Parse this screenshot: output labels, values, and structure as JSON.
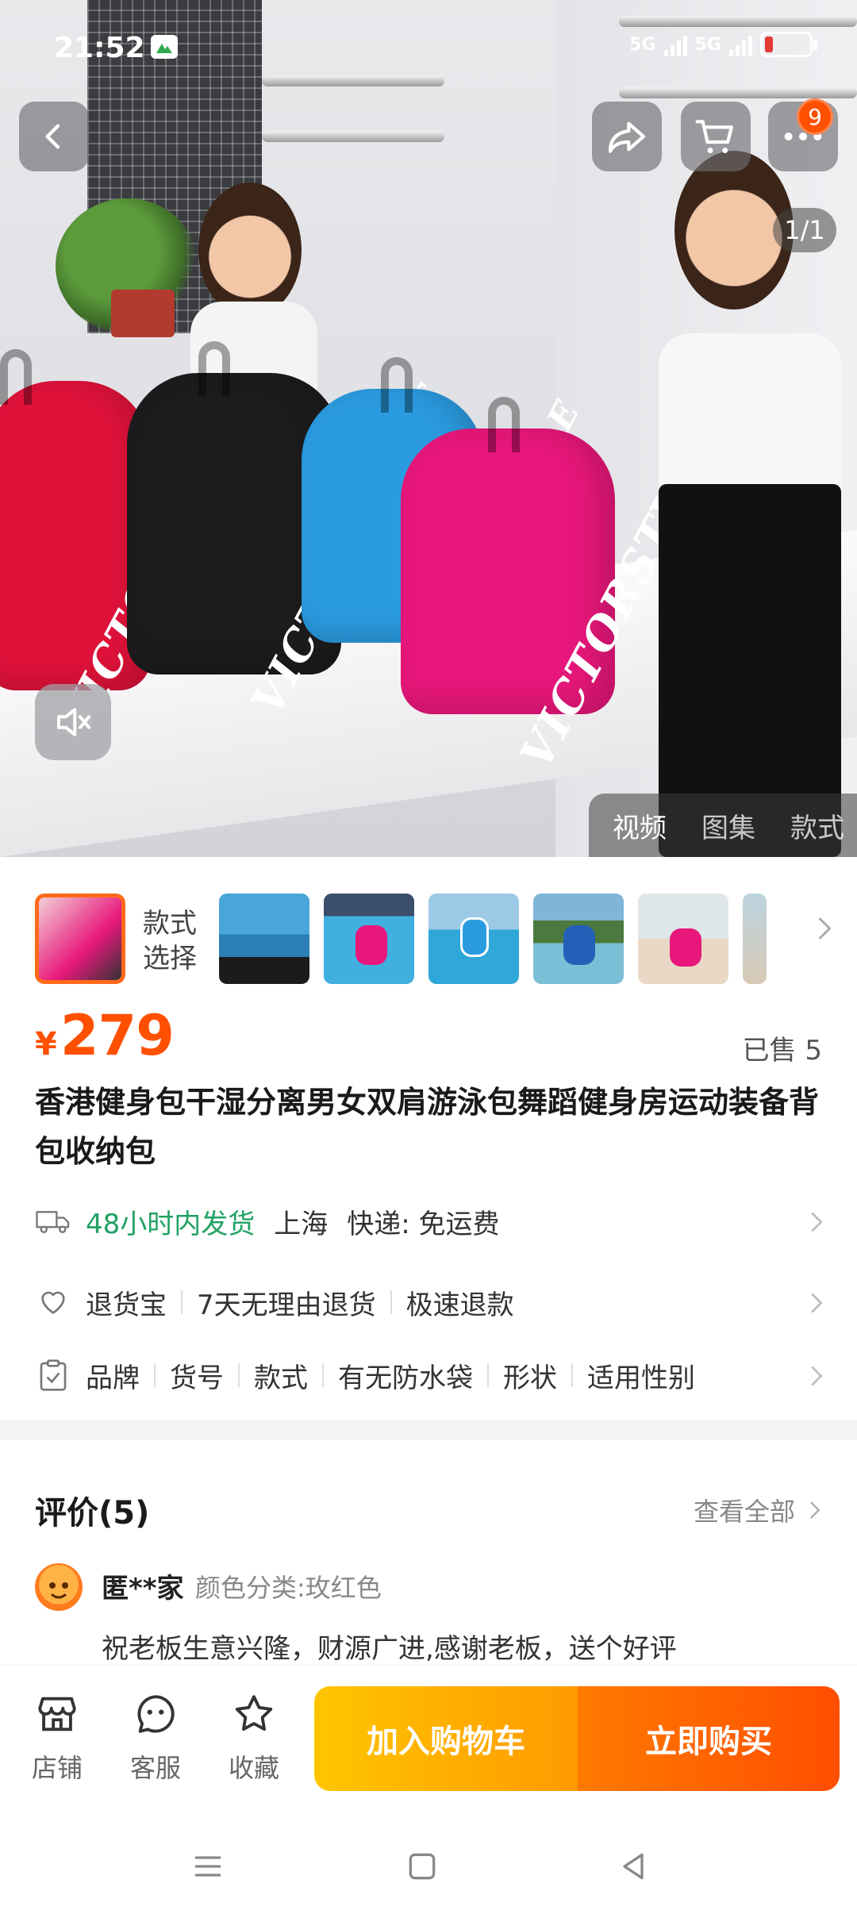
{
  "status_bar": {
    "time": "21:52",
    "network_1": "5G",
    "network_2": "5G",
    "battery_color": "#e53935"
  },
  "nav": {
    "cart_badge": "9"
  },
  "media": {
    "page_counter": "1/1",
    "tabs": [
      "视频",
      "图集",
      "款式"
    ],
    "active_tab": "视频",
    "bag_logo": "VICTORSTYLE",
    "bag_colors": [
      "#e0123a",
      "#1c1c1e",
      "#2b9be0",
      "#e8177b"
    ]
  },
  "variants": {
    "label": "款式\n选择",
    "label_line1": "款式",
    "label_line2": "选择"
  },
  "product": {
    "currency": "¥",
    "price": "279",
    "sold": "已售 5",
    "title": "香港健身包干湿分离男女双肩游泳包舞蹈健身房运动装备背包收纳包"
  },
  "shipping": {
    "dispatch": "48小时内发货",
    "location": "上海",
    "courier": "快递: 免运费"
  },
  "services": {
    "items": [
      "退货宝",
      "7天无理由退货",
      "极速退款"
    ]
  },
  "params": {
    "items": [
      "品牌",
      "货号",
      "款式",
      "有无防水袋",
      "形状",
      "适用性别"
    ]
  },
  "reviews": {
    "title": "评价(5)",
    "view_all": "查看全部",
    "user": "匿**家",
    "spec": "颜色分类:玫红色",
    "text": "祝老板生意兴隆，财源广进,感谢老板，送个好评"
  },
  "actions": {
    "shop": "店铺",
    "service": "客服",
    "favorite": "收藏",
    "add_to_cart": "加入购物车",
    "buy_now": "立即购买"
  },
  "colors": {
    "accent": "#ff5000",
    "cart_gradient": [
      "#ffc500",
      "#ff9a00"
    ],
    "buy_gradient": [
      "#ff7a00",
      "#ff4e00"
    ],
    "dispatch_green": "#20a162"
  }
}
